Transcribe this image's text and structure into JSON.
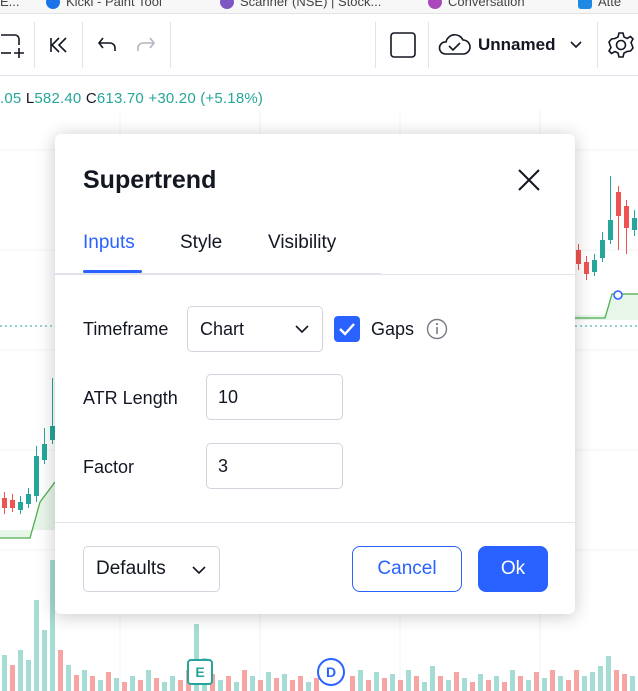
{
  "bookmarks": [
    {
      "label": "E...",
      "color": "#f4b400"
    },
    {
      "label": "Kicki - Paint Tool",
      "color": "#1a73e8"
    },
    {
      "label": "Scanner (NSE) | Stock...",
      "color": "#7e57c2"
    },
    {
      "label": "Conversation",
      "color": "#ab47bc"
    },
    {
      "label": "Atte",
      "color": "#1e88e5"
    }
  ],
  "toolbar": {
    "layout_name": "Unnamed"
  },
  "ohlc": {
    "open_tail": ".05",
    "low_key": "L",
    "low_value": "582.40",
    "close_key": "C",
    "close_value": "613.70",
    "change": "+30.20 (+5.18%)"
  },
  "dialog": {
    "title": "Supertrend",
    "tabs": [
      {
        "label": "Inputs",
        "active": true
      },
      {
        "label": "Style",
        "active": false
      },
      {
        "label": "Visibility",
        "active": false
      }
    ],
    "timeframe_label": "Timeframe",
    "timeframe_value": "Chart",
    "gaps_label": "Gaps",
    "gaps_checked": true,
    "atr_label": "ATR Length",
    "atr_value": "10",
    "factor_label": "Factor",
    "factor_value": "3",
    "defaults_label": "Defaults",
    "cancel_label": "Cancel",
    "ok_label": "Ok"
  },
  "markers": {
    "earnings": "E",
    "dividend": "D"
  },
  "colors": {
    "accent": "#2962ff",
    "up": "#26a69a",
    "down": "#ef5350",
    "supertrend": "#4caf50"
  }
}
